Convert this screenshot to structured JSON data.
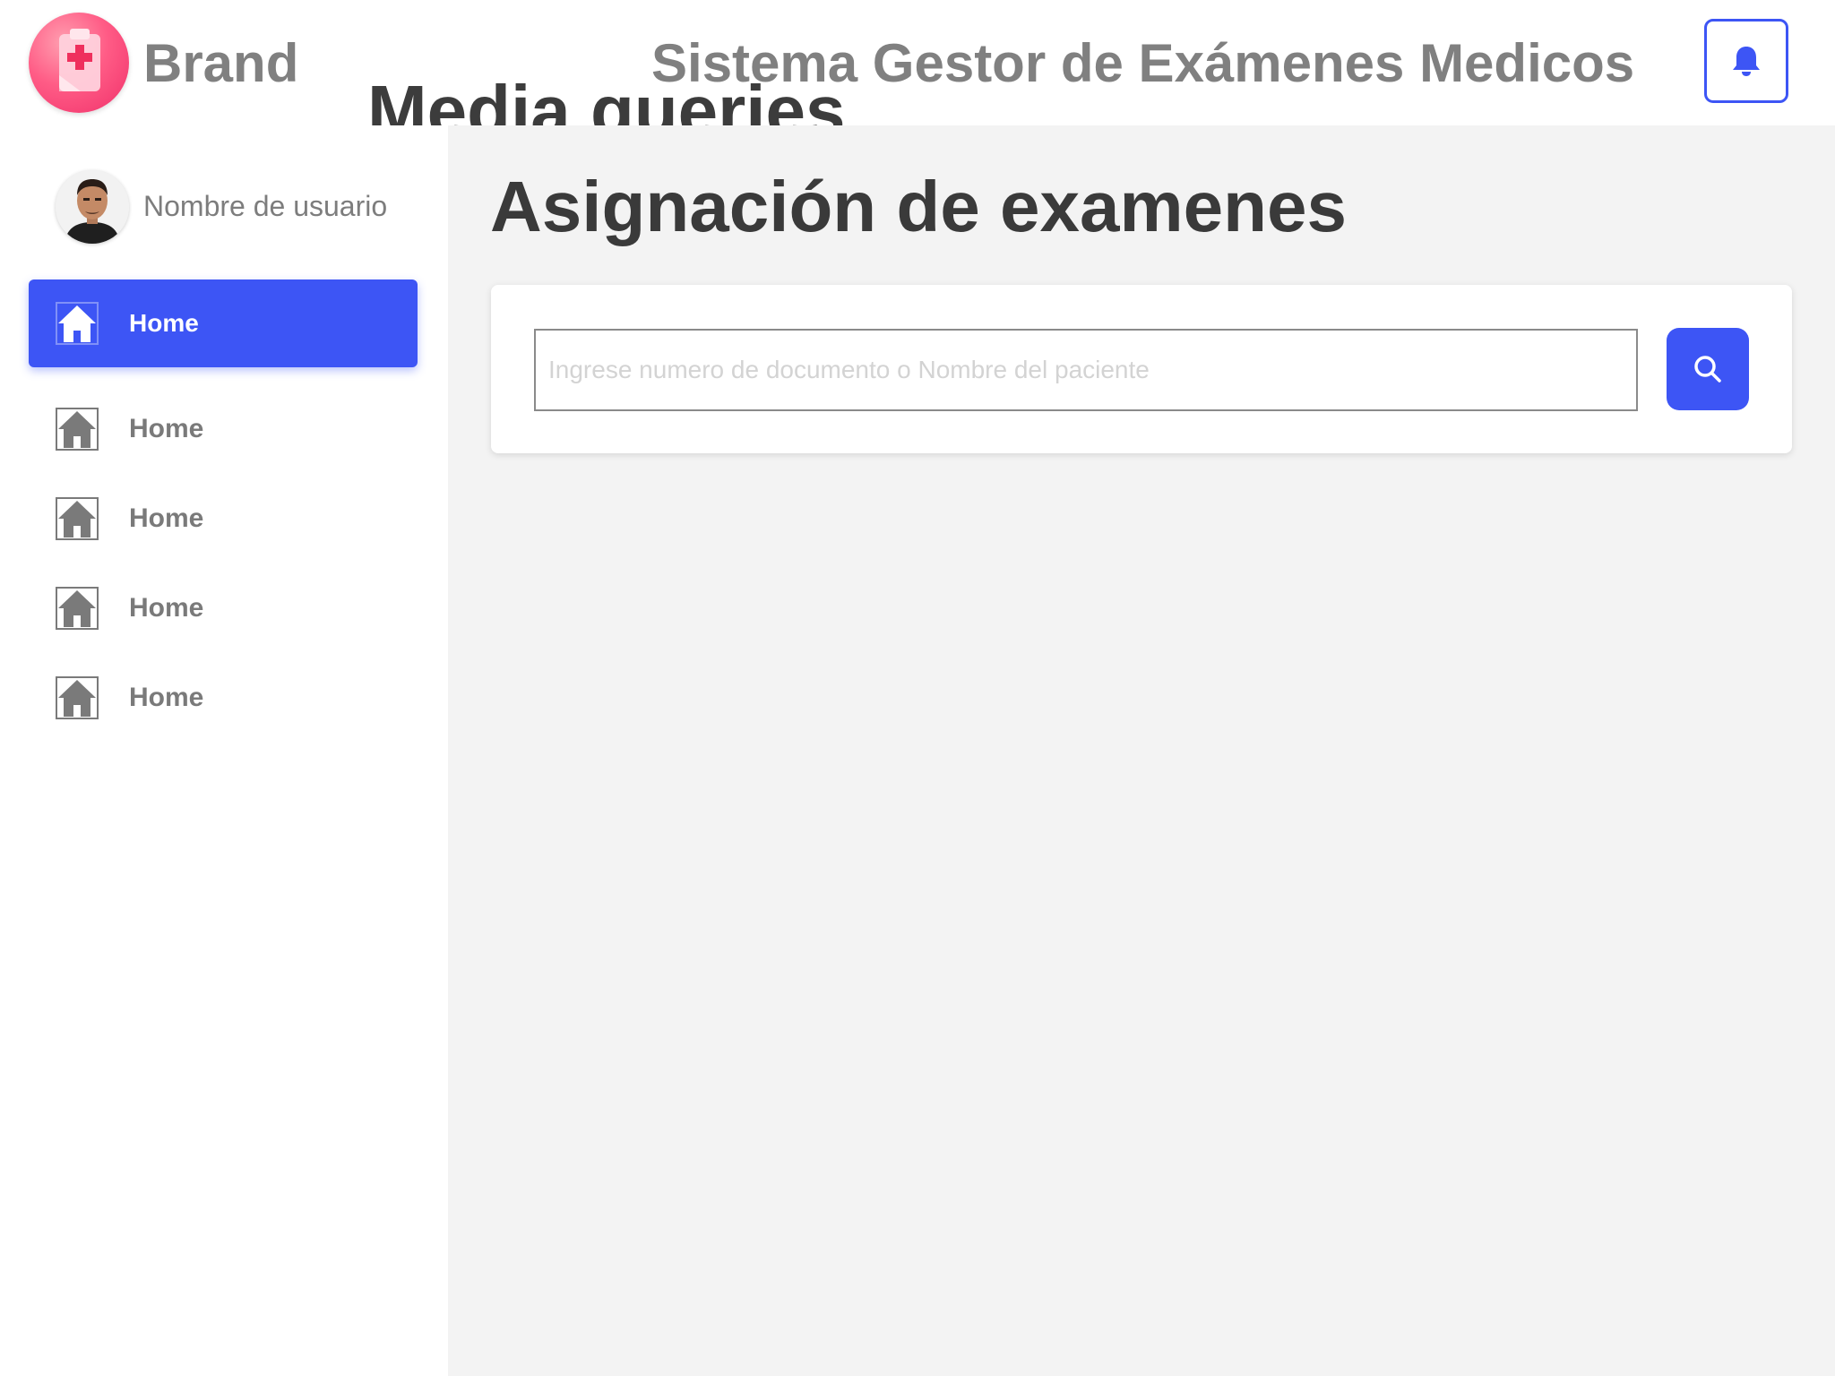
{
  "header": {
    "brand": "Brand",
    "app_title": "Sistema Gestor de Exámenes Medicos",
    "overlay_title": "Media queries",
    "notification_icon": "bell-icon"
  },
  "sidebar": {
    "user_name": "Nombre de usuario",
    "items": [
      {
        "label": "Home",
        "icon": "home-icon",
        "active": true
      },
      {
        "label": "Home",
        "icon": "home-icon",
        "active": false
      },
      {
        "label": "Home",
        "icon": "home-icon",
        "active": false
      },
      {
        "label": "Home",
        "icon": "home-icon",
        "active": false
      },
      {
        "label": "Home",
        "icon": "home-icon",
        "active": false
      }
    ]
  },
  "main": {
    "page_title": "Asignación de examenes",
    "search": {
      "placeholder": "Ingrese numero de documento o Nombre del paciente",
      "value": "",
      "button_icon": "search-icon"
    }
  },
  "colors": {
    "accent": "#3d55f5",
    "text_gray": "#808080",
    "text_dark": "#3a3a3a",
    "main_bg": "#f3f3f3",
    "logo_pink": "#f0306a"
  }
}
